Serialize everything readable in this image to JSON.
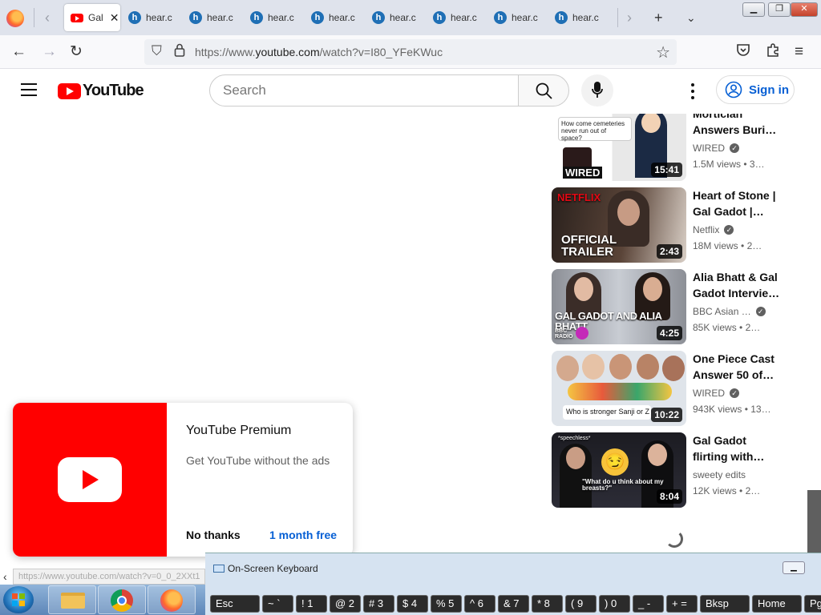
{
  "browser": {
    "active_tab": {
      "title": "Gal",
      "favicon": "youtube-icon"
    },
    "other_tabs": [
      {
        "title": "hear.c",
        "favicon": "hear-icon"
      },
      {
        "title": "hear.c",
        "favicon": "hear-icon"
      },
      {
        "title": "hear.c",
        "favicon": "hear-icon"
      },
      {
        "title": "hear.c",
        "favicon": "hear-icon"
      },
      {
        "title": "hear.c",
        "favicon": "hear-icon"
      },
      {
        "title": "hear.c",
        "favicon": "hear-icon"
      },
      {
        "title": "hear.c",
        "favicon": "hear-icon"
      },
      {
        "title": "hear.c",
        "favicon": "hear-icon"
      }
    ],
    "url_prefix": "https://www.",
    "url_domain": "youtube.com",
    "url_path": "/watch?v=I80_YFeKWuc"
  },
  "youtube": {
    "logo_text": "YouTube",
    "search_placeholder": "Search",
    "sign_in": "Sign in"
  },
  "recommendations": [
    {
      "title": "Mortician Answers Buri…",
      "channel": "WIRED",
      "verified": true,
      "views": "1.5M views",
      "age": "3…",
      "duration": "15:41",
      "thumb_text": "How come cemeteries never run out of space?",
      "thumb_label": "WIRED"
    },
    {
      "title": "Heart of Stone | Gal Gadot |…",
      "channel": "Netflix",
      "verified": true,
      "views": "18M views",
      "age": "2…",
      "duration": "2:43",
      "thumb_brand": "NETFLIX",
      "thumb_text": "OFFICIAL TRAILER"
    },
    {
      "title": "Alia Bhatt & Gal Gadot Intervie…",
      "channel": "BBC Asian …",
      "verified": true,
      "views": "85K views",
      "age": "2…",
      "duration": "4:25",
      "thumb_text": "GAL GADOT AND ALIA BHATT",
      "thumb_label": "BBC RADIO"
    },
    {
      "title": "One Piece Cast Answer 50 of…",
      "channel": "WIRED",
      "verified": true,
      "views": "943K views",
      "age": "13…",
      "duration": "10:22",
      "thumb_text": "Who is stronger Sanji or Z"
    },
    {
      "title": "Gal Gadot flirting with…",
      "channel": "sweety edits",
      "verified": false,
      "views": "12K views",
      "age": "2…",
      "duration": "8:04",
      "thumb_text": "\"What do u think about my breasts?\"",
      "thumb_label": "*speechless*"
    }
  ],
  "premium": {
    "title": "YouTube Premium",
    "subtitle": "Get YouTube without the ads",
    "no_thanks": "No thanks",
    "trial": "1 month free"
  },
  "status_url": "https://www.youtube.com/watch?v=0_0_2XXt1",
  "osk": {
    "title": "On-Screen Keyboard",
    "keys": [
      {
        "label": "Esc",
        "size": "wide"
      },
      {
        "label": "~ `",
        "size": "sm"
      },
      {
        "label": "! 1",
        "size": "sm"
      },
      {
        "label": "@ 2",
        "size": "sm"
      },
      {
        "label": "# 3",
        "size": "sm"
      },
      {
        "label": "$ 4",
        "size": "sm"
      },
      {
        "label": "% 5",
        "size": "sm"
      },
      {
        "label": "^ 6",
        "size": "sm"
      },
      {
        "label": "& 7",
        "size": "sm"
      },
      {
        "label": "* 8",
        "size": "sm"
      },
      {
        "label": "( 9",
        "size": "sm"
      },
      {
        "label": ") 0",
        "size": "sm"
      },
      {
        "label": "_ -",
        "size": "sm"
      },
      {
        "label": "+ =",
        "size": "sm"
      },
      {
        "label": "Bksp",
        "size": "wide"
      },
      {
        "label": "Home",
        "size": "wide"
      },
      {
        "label": "Pg",
        "size": "sm"
      }
    ]
  },
  "colors": {
    "youtube_red": "#ff0000",
    "link_blue": "#065fd4"
  }
}
